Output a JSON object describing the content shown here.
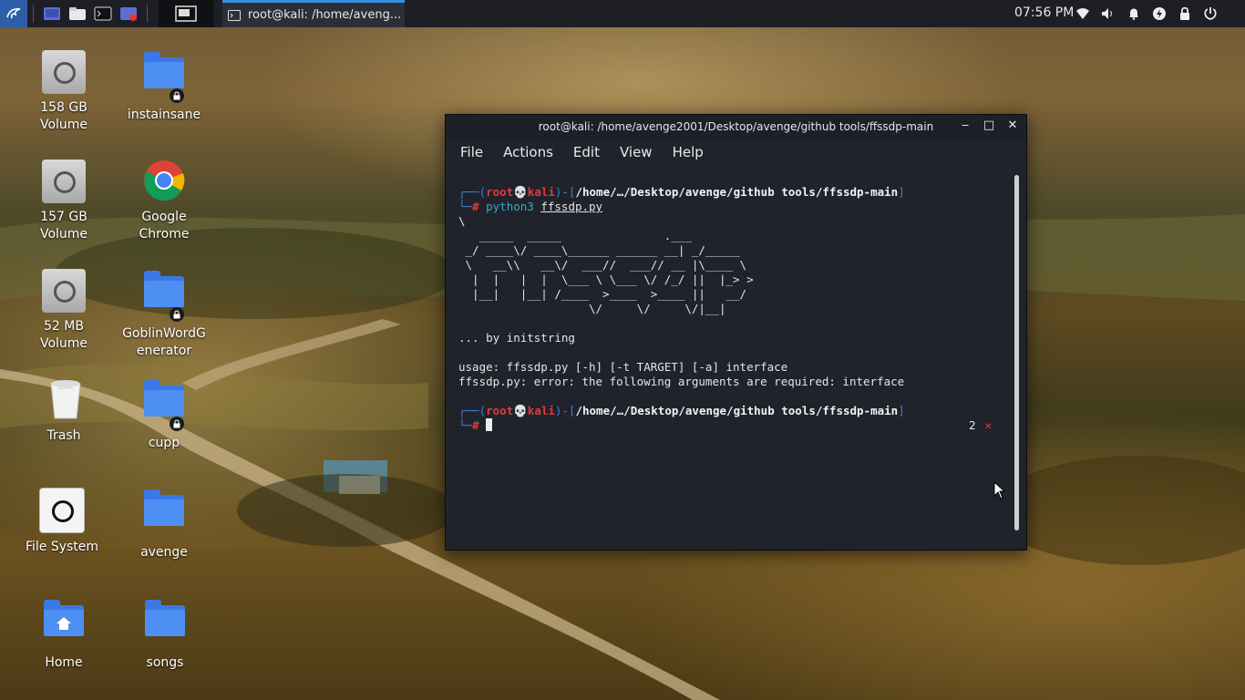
{
  "panel": {
    "task_title": "root@kali: /home/aveng...",
    "clock": "07:56 PM"
  },
  "desktop": {
    "icons": [
      {
        "label": "158 GB\nVolume",
        "kind": "drive-icon"
      },
      {
        "label": "instainsane",
        "kind": "locked-folder-icon"
      },
      {
        "label": "157 GB\nVolume",
        "kind": "drive-icon"
      },
      {
        "label": "Google\nChrome",
        "kind": "chrome-icon"
      },
      {
        "label": "52 MB\nVolume",
        "kind": "drive-icon"
      },
      {
        "label": "GoblinWordG\nenerator",
        "kind": "locked-folder-icon"
      },
      {
        "label": "Trash",
        "kind": "trash-icon"
      },
      {
        "label": "cupp",
        "kind": "locked-folder-icon"
      },
      {
        "label": "File System",
        "kind": "filesystem-icon"
      },
      {
        "label": "avenge",
        "kind": "folder-icon"
      },
      {
        "label": "Home",
        "kind": "home-folder-icon"
      },
      {
        "label": "songs",
        "kind": "folder-icon"
      }
    ]
  },
  "terminal": {
    "title": "root@kali: /home/avenge2001/Desktop/avenge/github tools/ffssdp-main",
    "menu": [
      "File",
      "Actions",
      "Edit",
      "View",
      "Help"
    ],
    "prompt_user": "root",
    "prompt_host": "kali",
    "prompt_path": "/home/…/Desktop/avenge/github tools/ffssdp-main",
    "command_bin": "python3",
    "command_arg": "ffssdp.py",
    "banner": "\\\n   _____  _____               .___\n _/ ____\\/ ____\\______ ______ __| _/_____\n \\   __\\\\   __\\/  ___//  ___// __ |\\____ \\\n  |  |   |  |  \\___ \\ \\___ \\/ /_/ ||  |_> >\n  |__|   |__| /____  >____  >____ ||   __/\n                   \\/     \\/     \\/|__|",
    "byline": "... by initstring",
    "usage": "usage: ffssdp.py [-h] [-t TARGET] [-a] interface",
    "error": "ffssdp.py: error: the following arguments are required: interface",
    "exit_code": "2",
    "exit_mark": "✕"
  },
  "colors": {
    "prompt_blue": "#3a80d6",
    "prompt_red": "#e23a3a",
    "terminal_bg": "#20232b",
    "panel_bg": "#1d1f24"
  }
}
